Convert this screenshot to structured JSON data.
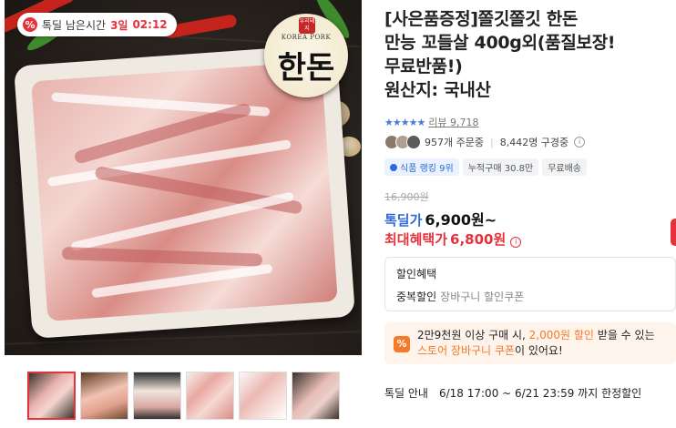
{
  "hero": {
    "timer_label": "톡딜 남은시간",
    "timer_days": "3일",
    "timer_time": "02:12",
    "timer_icon": "percent-badge-icon",
    "seal": {
      "stamp": "우리돼지",
      "brand_en": "KOREA PORK",
      "brand_ko": "한돈"
    }
  },
  "thumbnails": [
    {
      "selected": true
    },
    {
      "selected": false
    },
    {
      "selected": false
    },
    {
      "selected": false
    },
    {
      "selected": false
    },
    {
      "selected": false
    }
  ],
  "product": {
    "title_lines": [
      "[사은품증정]쫄깃쫄깃 한돈",
      "만능 꼬들살 400g외(품질보장!",
      "무료반품!)",
      "원산지: 국내산"
    ],
    "stars": "★★★★★",
    "review_label": "리뷰 9,718",
    "orders": "957개 주문중",
    "subscribers": "8,442명 구경중",
    "badges": {
      "rank": "식품 랭킹 9위",
      "cumulative": "누적구매 30.8만",
      "shipping": "무료배송"
    },
    "original_price": "16,900원",
    "deal_label": "톡딜가",
    "deal_price": "6,900원~",
    "max_label": "최대혜택가",
    "max_price": "6,800원"
  },
  "discount": {
    "title": "할인혜택",
    "line_label": "중복할인",
    "line_value": "장바구니 할인쿠폰"
  },
  "promo": {
    "icon": "percent-icon",
    "line1_a": "2만9천원 이상 구매 시, ",
    "line1_b": "2,000원 할인",
    "line1_c": " 받을 수 있는",
    "line2_a": "스토어 장바구니 쿠폰",
    "line2_b": "이 있어요!"
  },
  "notice": {
    "label": "톡딜 안내",
    "period": "6/18 17:00 ~ 6/21 23:59 까지 한정할인"
  },
  "colors": {
    "accent_red": "#e6323c",
    "accent_blue": "#2f6bd8",
    "promo_orange": "#f47a28"
  }
}
